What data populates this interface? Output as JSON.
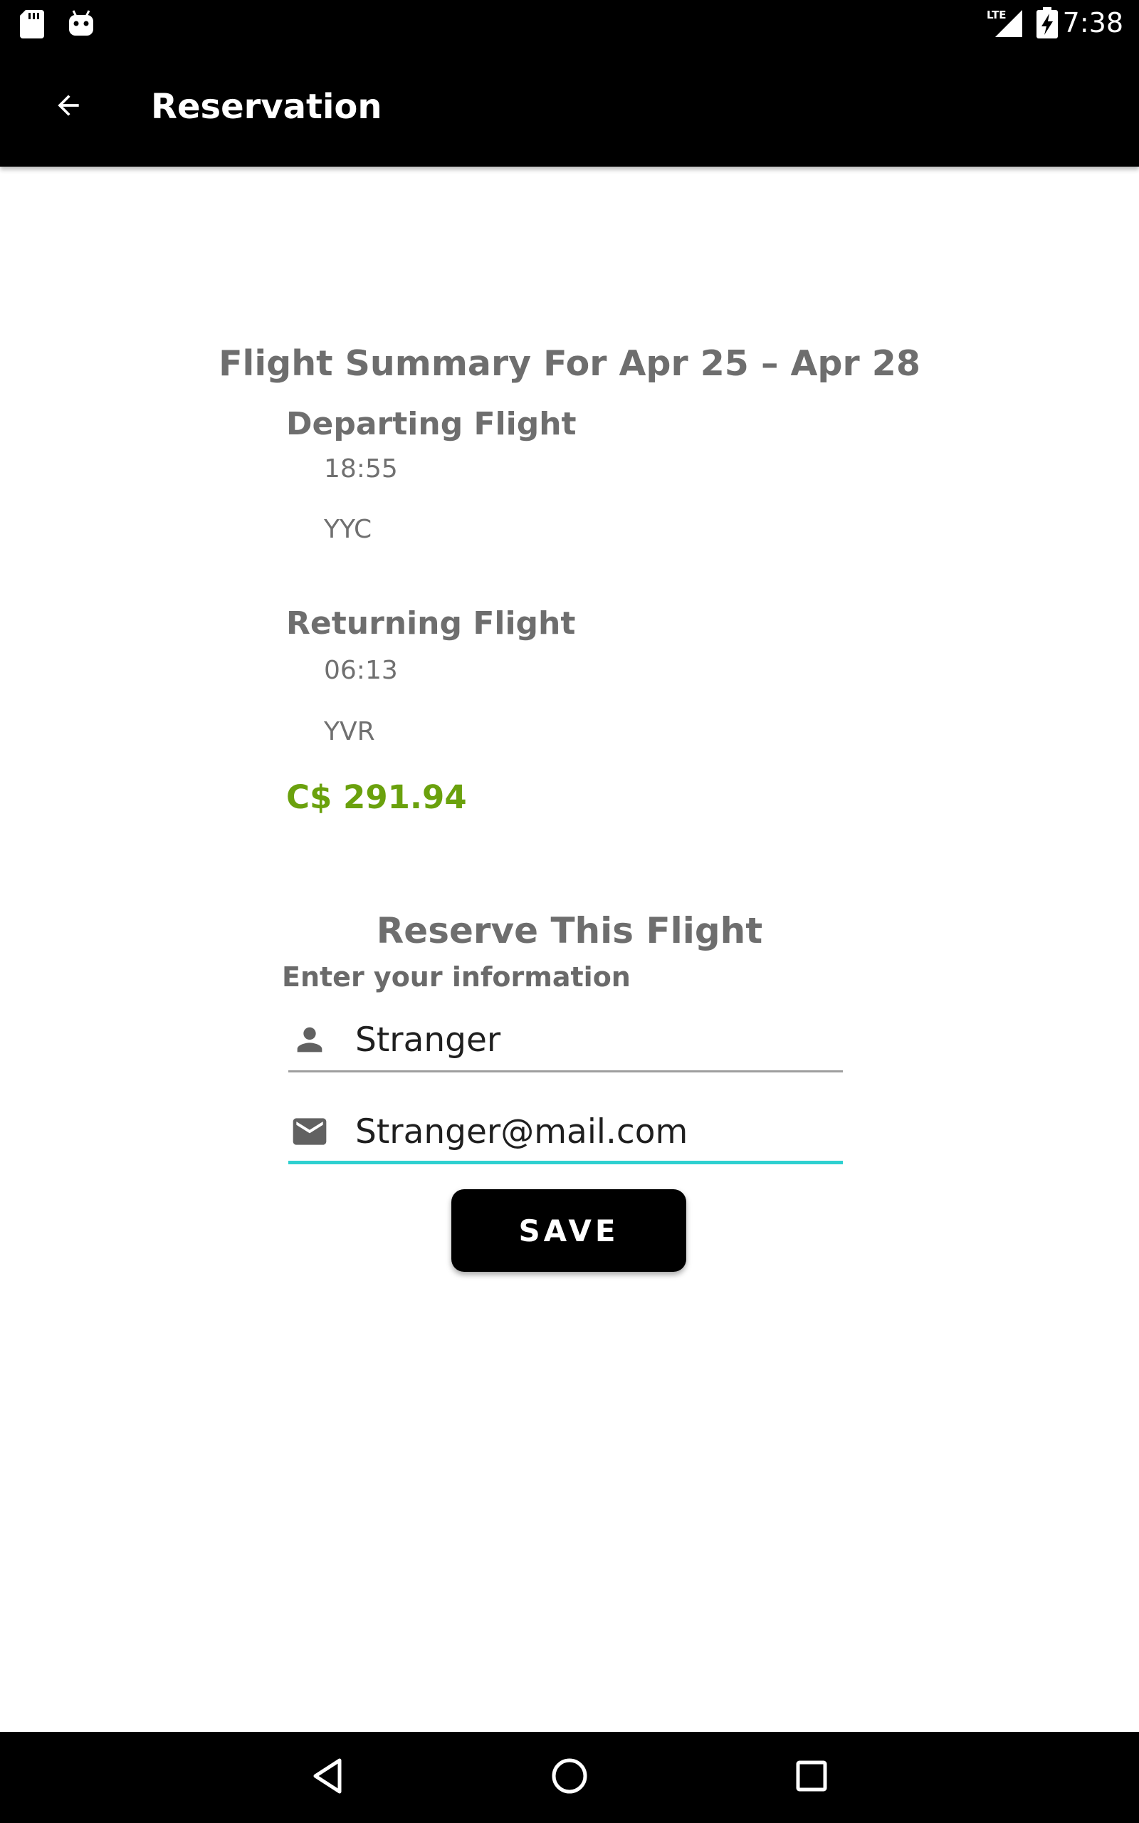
{
  "status_bar": {
    "time": "7:38",
    "network": "LTE",
    "icons": [
      "sd-card-icon",
      "android-icon",
      "lte-signal-icon",
      "battery-charging-icon"
    ]
  },
  "app_bar": {
    "title": "Reservation",
    "back_icon": "arrow-back-icon"
  },
  "summary": {
    "title": "Flight Summary For Apr 25 – Apr 28",
    "departing": {
      "label": "Departing Flight",
      "time": "18:55",
      "airport": "YYC"
    },
    "returning": {
      "label": "Returning Flight",
      "time": "06:13",
      "airport": "YVR"
    },
    "price": "C$ 291.94",
    "price_color": "#6aa10d"
  },
  "reserve": {
    "title": "Reserve This Flight",
    "subtitle": "Enter your information",
    "name_field": {
      "value": "Stranger",
      "icon": "person-icon"
    },
    "email_field": {
      "value": "Stranger@mail.com",
      "icon": "mail-icon",
      "focused": true
    },
    "save_label": "SAVE"
  },
  "colors": {
    "accent": "#2ed0d0",
    "bar_background": "#000000",
    "muted_text": "#6e6e6e"
  },
  "nav_bar": {
    "icons": [
      "nav-back-icon",
      "nav-home-icon",
      "nav-recents-icon"
    ]
  }
}
